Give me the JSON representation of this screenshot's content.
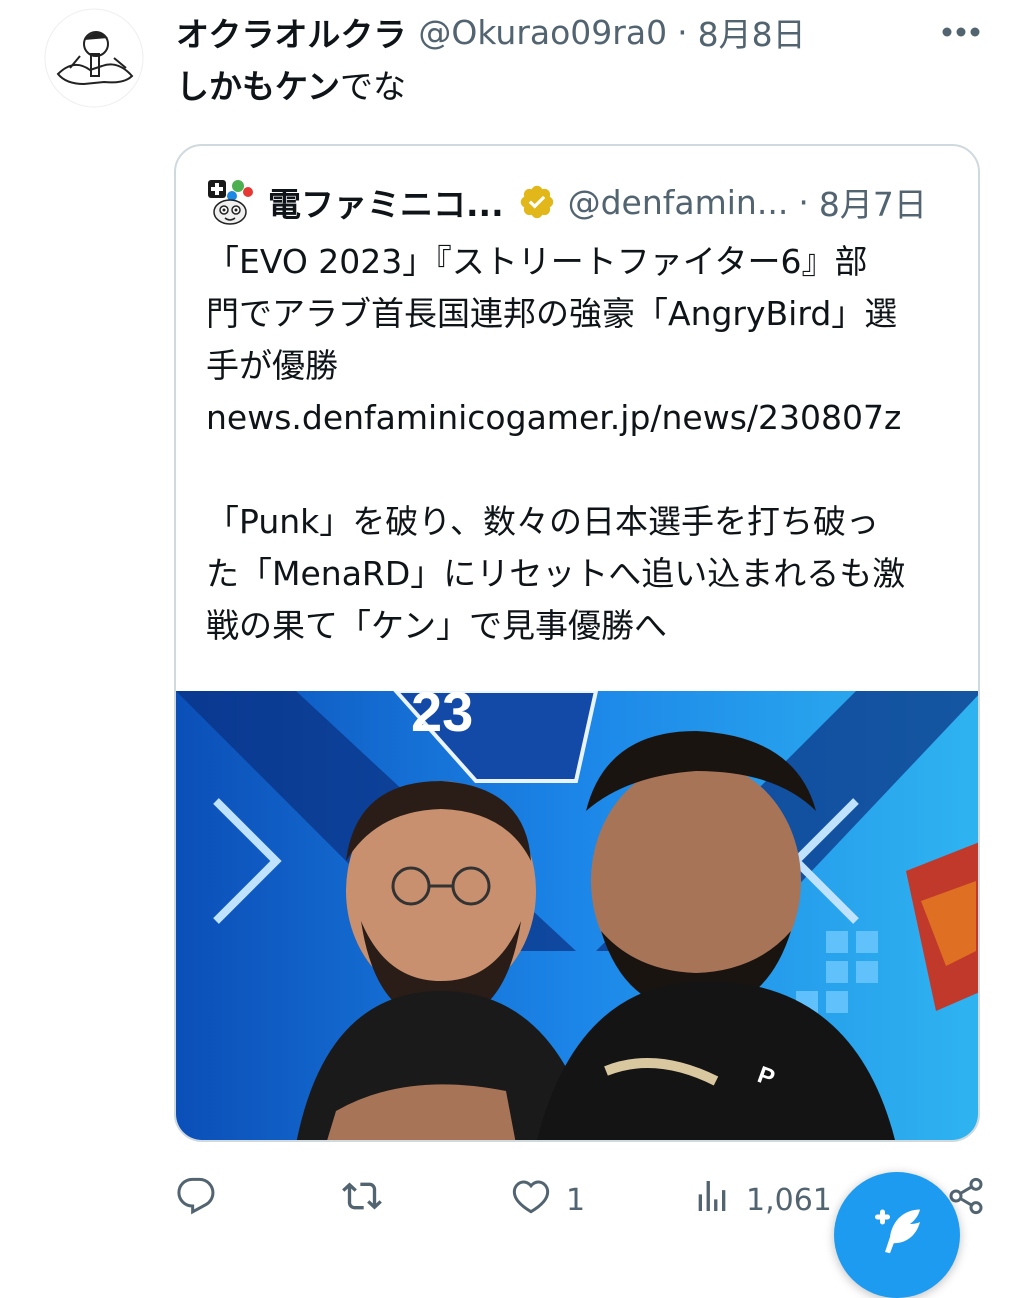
{
  "tweet": {
    "author_name": "オクラオルクラ",
    "author_handle": "@Okurao09ra0",
    "separator": "·",
    "date": "8月8日",
    "text_bold": "しかもケン",
    "text_rest": "でな"
  },
  "quote": {
    "author_name": "電ファミニコ...",
    "author_handle": "@denfamin...",
    "separator": "·",
    "date": "8月7日",
    "lines": [
      "「EVO 2023」『ストリートファイター6』部",
      "門でアラブ首長国連邦の強豪「AngryBird」選",
      "手が優勝",
      "news.denfaminicogamer.jp/news/230807z"
    ],
    "lines2": [
      "「Punk」を破り、数々の日本選手を打ち破っ",
      "た「MenaRD」にリセットへ追い込まれるも激",
      "戦の果て「ケン」で見事優勝へ"
    ],
    "image_banner_text": "23"
  },
  "actions": {
    "reply_count": "",
    "retweet_count": "",
    "like_count": "1",
    "views_count": "1,061"
  },
  "icons": {
    "more": "more-icon",
    "reply": "reply-icon",
    "retweet": "retweet-icon",
    "like": "heart-icon",
    "views": "views-icon",
    "share": "share-icon",
    "compose": "compose-icon",
    "verified": "verified-badge-icon"
  },
  "colors": {
    "accent": "#1d9bf0",
    "verified_gold": "#e2b719",
    "muted": "#536471"
  }
}
